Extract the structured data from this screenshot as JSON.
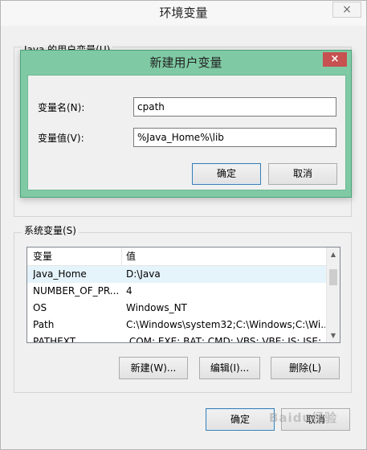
{
  "outer_window": {
    "title": "环境变量",
    "close_glyph": "×",
    "user_group_label": "Java 的用户变量(U)",
    "system_group_label": "系统变量(S)",
    "table": {
      "headers": [
        "变量",
        "值"
      ],
      "rows": [
        {
          "name": "Java_Home",
          "value": "D:\\Java",
          "selected": true
        },
        {
          "name": "NUMBER_OF_PR...",
          "value": "4"
        },
        {
          "name": "OS",
          "value": "Windows_NT"
        },
        {
          "name": "Path",
          "value": "C:\\Windows\\system32;C:\\Windows;C:\\Wi..."
        },
        {
          "name": "PATHEXT",
          "value": ".COM;.EXE;.BAT;.CMD;.VBS;.VBE;.JS;.JSE;..."
        }
      ]
    },
    "buttons": {
      "new": "新建(W)...",
      "edit": "编辑(I)...",
      "delete": "删除(L)",
      "ok": "确定",
      "cancel": "取消"
    }
  },
  "dialog": {
    "title": "新建用户变量",
    "close_glyph": "×",
    "name_label": "变量名(N):",
    "name_value": "cpath",
    "value_label": "变量值(V):",
    "value_value": "%Java_Home%\\lib",
    "ok": "确定",
    "cancel": "取消"
  },
  "watermark": "Baidu经验",
  "colors": {
    "dialog_frame": "#7fcaa4",
    "close_button": "#c75050",
    "selected_row": "#e5f3fb"
  }
}
